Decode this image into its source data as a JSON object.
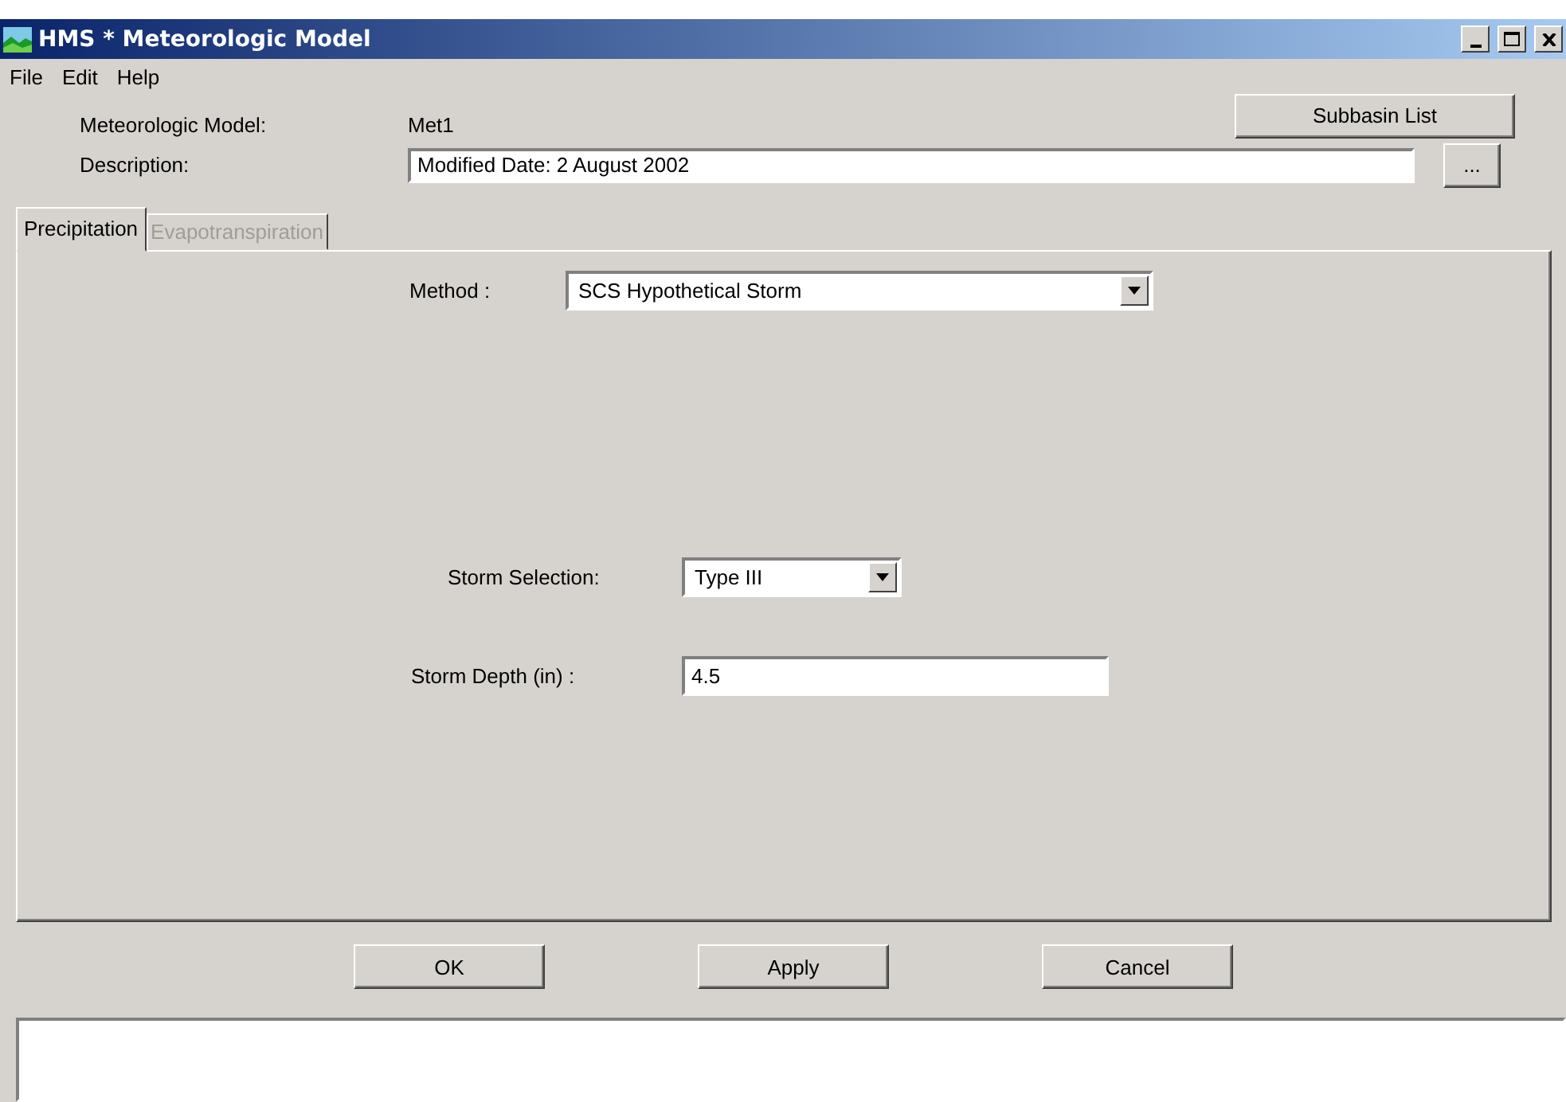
{
  "window": {
    "title": "HMS * Meteorologic Model"
  },
  "menu": [
    "File",
    "Edit",
    "Help"
  ],
  "model": {
    "label": "Meteorologic Model:",
    "value": "Met1"
  },
  "subbasin_button": "Subbasin List",
  "description": {
    "label": "Description:",
    "value": "Modified Date: 2 August 2002",
    "browse": "..."
  },
  "tabs": [
    {
      "label": "Precipitation",
      "selected": true,
      "disabled": false
    },
    {
      "label": "Evapotranspiration",
      "selected": false,
      "disabled": true
    }
  ],
  "method": {
    "label": "Method :",
    "value": "SCS Hypothetical Storm"
  },
  "storm_selection": {
    "label": "Storm Selection:",
    "value": "Type III"
  },
  "storm_depth": {
    "label": "Storm Depth (in) :",
    "value": "4.5"
  },
  "buttons": [
    "OK",
    "Apply",
    "Cancel"
  ]
}
